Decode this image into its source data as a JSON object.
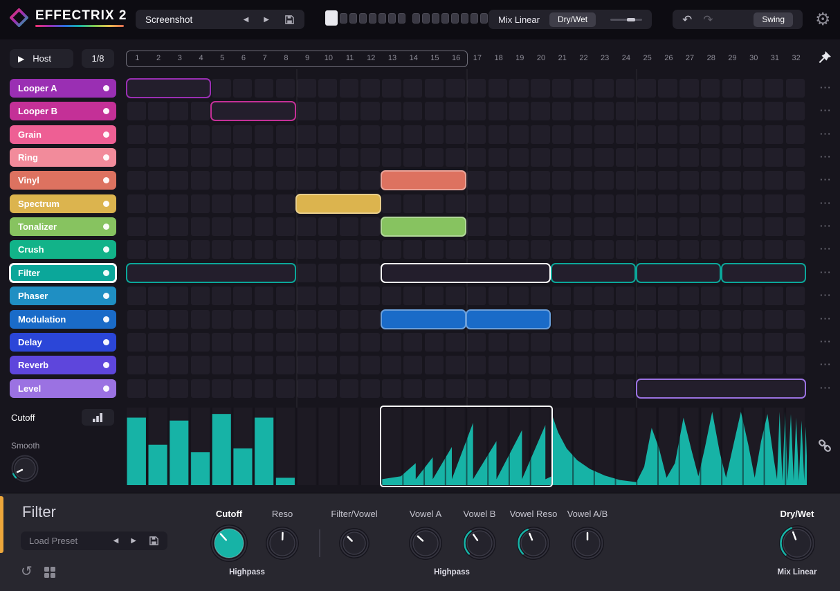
{
  "app": {
    "title": "EFFECTRIX 2"
  },
  "icons": {
    "play": "▶",
    "prev": "◀",
    "next": "▶",
    "undo": "↶",
    "redo": "↷",
    "gear": "⚙",
    "reset": "↺",
    "dots": "⋯"
  },
  "colors": {
    "accent": "#17b3a6",
    "selection": "#ffffff"
  },
  "topbar": {
    "preset_name": "Screenshot",
    "pattern": {
      "slots": 16,
      "active": 1
    },
    "mix_label": "Mix Linear",
    "drywet_label": "Dry/Wet",
    "swing_label": "Swing"
  },
  "transport": {
    "host_label": "Host",
    "rate_label": "1/8"
  },
  "tracks": [
    {
      "name": "Looper A",
      "color": "#9a2fb3"
    },
    {
      "name": "Looper B",
      "color": "#c43097"
    },
    {
      "name": "Grain",
      "color": "#ee5f94"
    },
    {
      "name": "Ring",
      "color": "#f28b9b"
    },
    {
      "name": "Vinyl",
      "color": "#dd7260"
    },
    {
      "name": "Spectrum",
      "color": "#dcb44e"
    },
    {
      "name": "Tonalizer",
      "color": "#87c360"
    },
    {
      "name": "Crush",
      "color": "#12b389"
    },
    {
      "name": "Filter",
      "color": "#0ba79a",
      "selected": true
    },
    {
      "name": "Phaser",
      "color": "#1f8fc3"
    },
    {
      "name": "Modulation",
      "color": "#1a6bc8"
    },
    {
      "name": "Delay",
      "color": "#2b46d8"
    },
    {
      "name": "Reverb",
      "color": "#5e46dc"
    },
    {
      "name": "Level",
      "color": "#9b72e2"
    }
  ],
  "grid": {
    "steps": 32,
    "loop_length": 16,
    "numbers": [
      "1",
      "2",
      "3",
      "4",
      "5",
      "6",
      "7",
      "8",
      "9",
      "10",
      "11",
      "12",
      "13",
      "14",
      "15",
      "16",
      "17",
      "18",
      "19",
      "20",
      "21",
      "22",
      "23",
      "24",
      "25",
      "26",
      "27",
      "28",
      "29",
      "30",
      "31",
      "32"
    ],
    "blocks": [
      {
        "track": 0,
        "start": 1,
        "len": 4,
        "style": "outline"
      },
      {
        "track": 1,
        "start": 5,
        "len": 4,
        "style": "outline"
      },
      {
        "track": 4,
        "start": 13,
        "len": 4,
        "style": "filled"
      },
      {
        "track": 5,
        "start": 9,
        "len": 4,
        "style": "filled"
      },
      {
        "track": 6,
        "start": 13,
        "len": 4,
        "style": "filled"
      },
      {
        "track": 8,
        "start": 1,
        "len": 8,
        "style": "outline"
      },
      {
        "track": 8,
        "start": 13,
        "len": 8,
        "style": "selected"
      },
      {
        "track": 8,
        "start": 21,
        "len": 4,
        "style": "outline"
      },
      {
        "track": 8,
        "start": 25,
        "len": 4,
        "style": "outline"
      },
      {
        "track": 8,
        "start": 29,
        "len": 4,
        "style": "outline"
      },
      {
        "track": 10,
        "start": 13,
        "len": 4,
        "style": "filled"
      },
      {
        "track": 10,
        "start": 17,
        "len": 4,
        "style": "filled"
      },
      {
        "track": 13,
        "start": 25,
        "len": 8,
        "style": "outline"
      }
    ]
  },
  "editor": {
    "label": "Cutoff",
    "smooth_label": "Smooth",
    "smooth_angle": -115,
    "segments": [
      {
        "type": "bars",
        "start": 0,
        "values": [
          0.92,
          0.55,
          0.88,
          0.45,
          0.97,
          0.5,
          0.92,
          0.1
        ]
      },
      {
        "type": "shape",
        "points": [
          [
            12,
            0.08
          ],
          [
            12.9,
            0.12
          ],
          [
            13.6,
            0.3
          ],
          [
            13.6,
            0.08
          ],
          [
            14.4,
            0.38
          ],
          [
            14.4,
            0.08
          ],
          [
            15.3,
            0.52
          ],
          [
            15.3,
            0.08
          ],
          [
            16.3,
            0.85
          ],
          [
            16.3,
            0.08
          ],
          [
            17.4,
            0.6
          ],
          [
            17.4,
            0.08
          ],
          [
            18.6,
            0.75
          ],
          [
            18.6,
            0.08
          ],
          [
            19.7,
            0.82
          ],
          [
            19.7,
            0.08
          ],
          [
            20,
            0.12
          ]
        ]
      },
      {
        "type": "shape",
        "points": [
          [
            20,
            0.97
          ],
          [
            20.3,
            0.72
          ],
          [
            20.7,
            0.5
          ],
          [
            21.2,
            0.34
          ],
          [
            21.8,
            0.22
          ],
          [
            22.5,
            0.13
          ],
          [
            23.2,
            0.07
          ],
          [
            24,
            0.04
          ]
        ]
      },
      {
        "type": "shape",
        "points": [
          [
            24,
            0.05
          ],
          [
            24.35,
            0.25
          ],
          [
            24.7,
            0.78
          ],
          [
            25.05,
            0.5
          ],
          [
            25.4,
            0.1
          ],
          [
            25.8,
            0.3
          ],
          [
            26.2,
            0.92
          ],
          [
            26.6,
            0.45
          ],
          [
            26.9,
            0.12
          ],
          [
            27.2,
            0.5
          ],
          [
            27.55,
            1.0
          ],
          [
            27.9,
            0.45
          ],
          [
            28.2,
            0.1
          ],
          [
            28.55,
            0.55
          ],
          [
            28.9,
            1.0
          ],
          [
            29.25,
            0.55
          ],
          [
            29.55,
            0.1
          ],
          [
            29.85,
            0.6
          ],
          [
            30.15,
            0.97
          ],
          [
            30.45,
            0.35
          ],
          [
            30.6,
            0.08
          ],
          [
            30.72,
            1.0
          ],
          [
            30.85,
            0.06
          ],
          [
            30.98,
            1.0
          ],
          [
            31.1,
            0.06
          ],
          [
            31.25,
            0.97
          ],
          [
            31.38,
            0.06
          ],
          [
            31.5,
            0.92
          ],
          [
            31.63,
            0.06
          ],
          [
            31.75,
            0.88
          ],
          [
            31.88,
            0.06
          ],
          [
            31.95,
            0.8
          ],
          [
            32,
            0.4
          ]
        ]
      }
    ]
  },
  "panel": {
    "title": "Filter",
    "preset_label": "Load Preset",
    "knobs": [
      {
        "label": "Cutoff",
        "angle": -42,
        "filled": true
      },
      {
        "label": "Reso",
        "angle": 2
      },
      {
        "label": "Filter/Vowel",
        "angle": -45
      },
      {
        "label": "Vowel A",
        "angle": -48
      },
      {
        "label": "Vowel B",
        "angle": -35,
        "arc": true
      },
      {
        "label": "Vowel Reso",
        "angle": -22,
        "arc": true
      },
      {
        "label": "Vowel A/B",
        "angle": 0
      },
      {
        "label": "Dry/Wet",
        "angle": -20,
        "arc": true
      }
    ],
    "sub_labels": [
      "Highpass",
      "Highpass",
      "Mix Linear"
    ]
  }
}
